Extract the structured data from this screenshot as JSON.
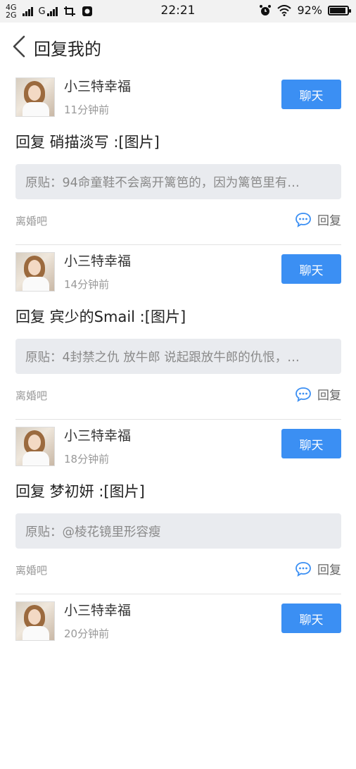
{
  "status_bar": {
    "net1_top": "4G",
    "net1_bottom": "2G",
    "net2": "G",
    "time": "22:21",
    "battery": "92%",
    "battery_level": 0.92
  },
  "header": {
    "title": "回复我的"
  },
  "posts": [
    {
      "username": "小三特幸福",
      "time": "11分钟前",
      "chat_label": "聊天",
      "reply": "回复 硝描淡写 :[图片]",
      "original": "原贴：94命童鞋不会离开篱笆的，因为篱笆里有…",
      "forum": "离婚吧",
      "reply_label": "回复"
    },
    {
      "username": "小三特幸福",
      "time": "14分钟前",
      "chat_label": "聊天",
      "reply": "回复 宾少的Smail :[图片]",
      "original": "原贴：4封禁之仇 放牛郎 说起跟放牛郎的仇恨，…",
      "forum": "离婚吧",
      "reply_label": "回复"
    },
    {
      "username": "小三特幸福",
      "time": "18分钟前",
      "chat_label": "聊天",
      "reply": "回复 梦初妍 :[图片]",
      "original": "原贴：@棱花镜里形容瘦",
      "forum": "离婚吧",
      "reply_label": "回复"
    },
    {
      "username": "小三特幸福",
      "time": "20分钟前",
      "chat_label": "聊天",
      "reply": "",
      "original": "",
      "forum": "",
      "reply_label": ""
    }
  ],
  "colors": {
    "accent": "#3b8ff3",
    "original_bg": "#e9ebef"
  }
}
